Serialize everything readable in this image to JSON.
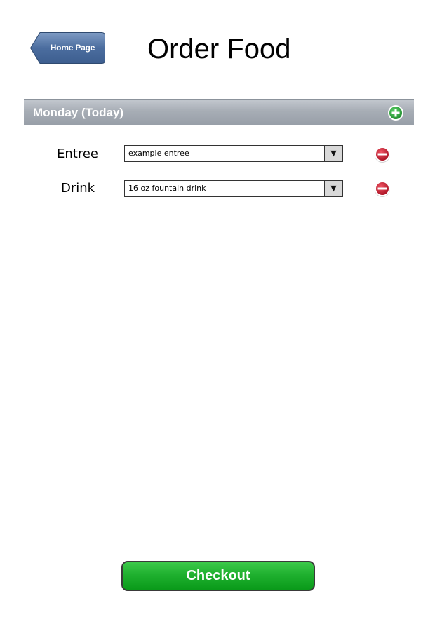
{
  "header": {
    "home_label": "Home Page",
    "title": "Order Food"
  },
  "day": {
    "label": "Monday (Today)",
    "add_icon": "plus-circle-icon"
  },
  "items": [
    {
      "label": "Entree",
      "value": "example entree",
      "dropdown_icon": "triangle-down-icon",
      "remove_icon": "minus-circle-icon"
    },
    {
      "label": "Drink",
      "value": "16 oz fountain drink",
      "dropdown_icon": "triangle-down-icon",
      "remove_icon": "minus-circle-icon"
    }
  ],
  "checkout_label": "Checkout",
  "colors": {
    "home_button": "#4b6d9f",
    "day_bar": "#a7adb5",
    "add_green": "#2ea43a",
    "remove_red": "#c8192c",
    "checkout_green": "#1fb02f"
  }
}
